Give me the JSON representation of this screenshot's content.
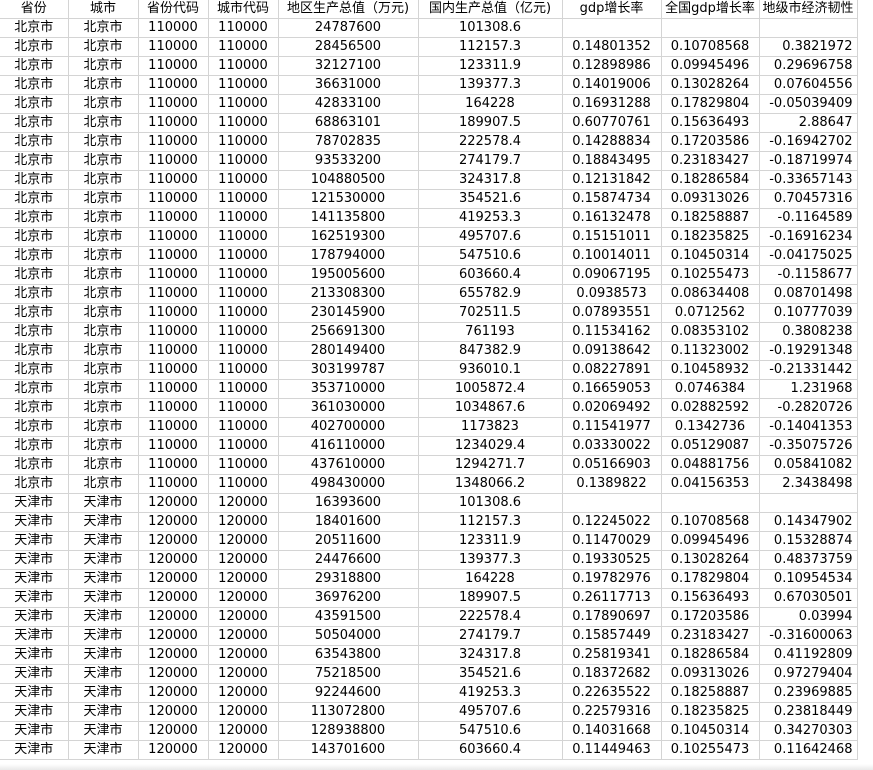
{
  "columns": [
    "省份",
    "城市",
    "省份代码",
    "城市代码",
    "地区生产总值（万元)",
    "国内生产总值（亿元)",
    "gdp增长率",
    "全国gdp增长率",
    "地级市经济韧性"
  ],
  "rows": [
    [
      "北京市",
      "北京市",
      "110000",
      "110000",
      "24787600",
      "101308.6",
      "",
      "",
      ""
    ],
    [
      "北京市",
      "北京市",
      "110000",
      "110000",
      "28456500",
      "112157.3",
      "0.14801352",
      "0.10708568",
      "0.3821972"
    ],
    [
      "北京市",
      "北京市",
      "110000",
      "110000",
      "32127100",
      "123311.9",
      "0.12898986",
      "0.09945496",
      "0.29696758"
    ],
    [
      "北京市",
      "北京市",
      "110000",
      "110000",
      "36631000",
      "139377.3",
      "0.14019006",
      "0.13028264",
      "0.07604556"
    ],
    [
      "北京市",
      "北京市",
      "110000",
      "110000",
      "42833100",
      "164228",
      "0.16931288",
      "0.17829804",
      "-0.05039409"
    ],
    [
      "北京市",
      "北京市",
      "110000",
      "110000",
      "68863101",
      "189907.5",
      "0.60770761",
      "0.15636493",
      "2.88647"
    ],
    [
      "北京市",
      "北京市",
      "110000",
      "110000",
      "78702835",
      "222578.4",
      "0.14288834",
      "0.17203586",
      "-0.16942702"
    ],
    [
      "北京市",
      "北京市",
      "110000",
      "110000",
      "93533200",
      "274179.7",
      "0.18843495",
      "0.23183427",
      "-0.18719974"
    ],
    [
      "北京市",
      "北京市",
      "110000",
      "110000",
      "104880500",
      "324317.8",
      "0.12131842",
      "0.18286584",
      "-0.33657143"
    ],
    [
      "北京市",
      "北京市",
      "110000",
      "110000",
      "121530000",
      "354521.6",
      "0.15874734",
      "0.09313026",
      "0.70457316"
    ],
    [
      "北京市",
      "北京市",
      "110000",
      "110000",
      "141135800",
      "419253.3",
      "0.16132478",
      "0.18258887",
      "-0.1164589"
    ],
    [
      "北京市",
      "北京市",
      "110000",
      "110000",
      "162519300",
      "495707.6",
      "0.15151011",
      "0.18235825",
      "-0.16916234"
    ],
    [
      "北京市",
      "北京市",
      "110000",
      "110000",
      "178794000",
      "547510.6",
      "0.10014011",
      "0.10450314",
      "-0.04175025"
    ],
    [
      "北京市",
      "北京市",
      "110000",
      "110000",
      "195005600",
      "603660.4",
      "0.09067195",
      "0.10255473",
      "-0.1158677"
    ],
    [
      "北京市",
      "北京市",
      "110000",
      "110000",
      "213308300",
      "655782.9",
      "0.0938573",
      "0.08634408",
      "0.08701498"
    ],
    [
      "北京市",
      "北京市",
      "110000",
      "110000",
      "230145900",
      "702511.5",
      "0.07893551",
      "0.0712562",
      "0.10777039"
    ],
    [
      "北京市",
      "北京市",
      "110000",
      "110000",
      "256691300",
      "761193",
      "0.11534162",
      "0.08353102",
      "0.3808238"
    ],
    [
      "北京市",
      "北京市",
      "110000",
      "110000",
      "280149400",
      "847382.9",
      "0.09138642",
      "0.11323002",
      "-0.19291348"
    ],
    [
      "北京市",
      "北京市",
      "110000",
      "110000",
      "303199787",
      "936010.1",
      "0.08227891",
      "0.10458932",
      "-0.21331442"
    ],
    [
      "北京市",
      "北京市",
      "110000",
      "110000",
      "353710000",
      "1005872.4",
      "0.16659053",
      "0.0746384",
      "1.231968"
    ],
    [
      "北京市",
      "北京市",
      "110000",
      "110000",
      "361030000",
      "1034867.6",
      "0.02069492",
      "0.02882592",
      "-0.2820726"
    ],
    [
      "北京市",
      "北京市",
      "110000",
      "110000",
      "402700000",
      "1173823",
      "0.11541977",
      "0.1342736",
      "-0.14041353"
    ],
    [
      "北京市",
      "北京市",
      "110000",
      "110000",
      "416110000",
      "1234029.4",
      "0.03330022",
      "0.05129087",
      "-0.35075726"
    ],
    [
      "北京市",
      "北京市",
      "110000",
      "110000",
      "437610000",
      "1294271.7",
      "0.05166903",
      "0.04881756",
      "0.05841082"
    ],
    [
      "北京市",
      "北京市",
      "110000",
      "110000",
      "498430000",
      "1348066.2",
      "0.1389822",
      "0.04156353",
      "2.3438498"
    ],
    [
      "天津市",
      "天津市",
      "120000",
      "120000",
      "16393600",
      "101308.6",
      "",
      "",
      ""
    ],
    [
      "天津市",
      "天津市",
      "120000",
      "120000",
      "18401600",
      "112157.3",
      "0.12245022",
      "0.10708568",
      "0.14347902"
    ],
    [
      "天津市",
      "天津市",
      "120000",
      "120000",
      "20511600",
      "123311.9",
      "0.11470029",
      "0.09945496",
      "0.15328874"
    ],
    [
      "天津市",
      "天津市",
      "120000",
      "120000",
      "24476600",
      "139377.3",
      "0.19330525",
      "0.13028264",
      "0.48373759"
    ],
    [
      "天津市",
      "天津市",
      "120000",
      "120000",
      "29318800",
      "164228",
      "0.19782976",
      "0.17829804",
      "0.10954534"
    ],
    [
      "天津市",
      "天津市",
      "120000",
      "120000",
      "36976200",
      "189907.5",
      "0.26117713",
      "0.15636493",
      "0.67030501"
    ],
    [
      "天津市",
      "天津市",
      "120000",
      "120000",
      "43591500",
      "222578.4",
      "0.17890697",
      "0.17203586",
      "0.03994"
    ],
    [
      "天津市",
      "天津市",
      "120000",
      "120000",
      "50504000",
      "274179.7",
      "0.15857449",
      "0.23183427",
      "-0.31600063"
    ],
    [
      "天津市",
      "天津市",
      "120000",
      "120000",
      "63543800",
      "324317.8",
      "0.25819341",
      "0.18286584",
      "0.41192809"
    ],
    [
      "天津市",
      "天津市",
      "120000",
      "120000",
      "75218500",
      "354521.6",
      "0.18372682",
      "0.09313026",
      "0.97279404"
    ],
    [
      "天津市",
      "天津市",
      "120000",
      "120000",
      "92244600",
      "419253.3",
      "0.22635522",
      "0.18258887",
      "0.23969885"
    ],
    [
      "天津市",
      "天津市",
      "120000",
      "120000",
      "113072800",
      "495707.6",
      "0.22579316",
      "0.18235825",
      "0.23818449"
    ],
    [
      "天津市",
      "天津市",
      "120000",
      "120000",
      "128938800",
      "547510.6",
      "0.14031668",
      "0.10450314",
      "0.34270303"
    ],
    [
      "天津市",
      "天津市",
      "120000",
      "120000",
      "143701600",
      "603660.4",
      "0.11449463",
      "0.10255473",
      "0.11642468"
    ]
  ]
}
